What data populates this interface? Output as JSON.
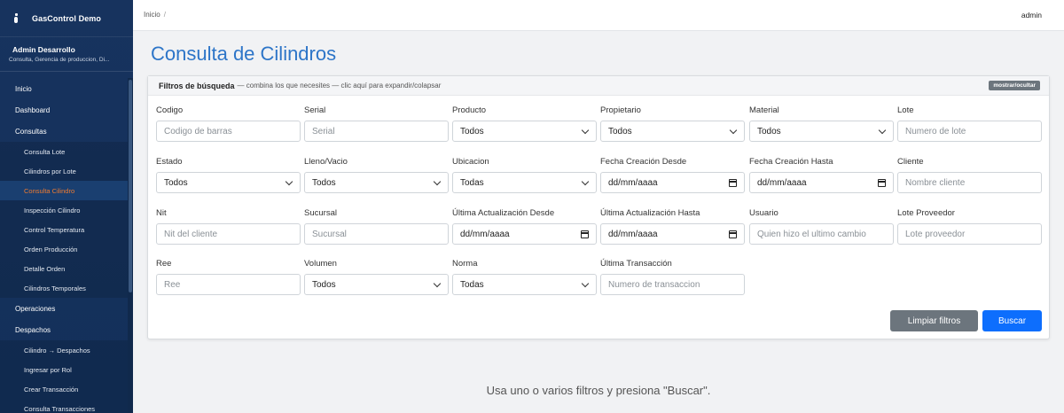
{
  "app": {
    "title": "GasControl Demo"
  },
  "user": {
    "name": "Admin Desarrollo",
    "role": "Consulta, Gerencia de produccion, Di..."
  },
  "topbar": {
    "breadcrumb": "Inicio",
    "separator": "/",
    "username": "admin"
  },
  "sidebar": {
    "items": [
      {
        "label": "Inicio",
        "type": "section"
      },
      {
        "label": "Dashboard",
        "type": "section"
      },
      {
        "label": "Consultas",
        "type": "section"
      },
      {
        "label": "Consulta Lote",
        "type": "sub"
      },
      {
        "label": "Cilindros por Lote",
        "type": "sub"
      },
      {
        "label": "Consulta Cilindro",
        "type": "sub",
        "active": true
      },
      {
        "label": "Inspección Cilindro",
        "type": "sub"
      },
      {
        "label": "Control Temperatura",
        "type": "sub"
      },
      {
        "label": "Orden Producción",
        "type": "sub"
      },
      {
        "label": "Detalle Orden",
        "type": "sub"
      },
      {
        "label": "Cilindros Temporales",
        "type": "sub"
      },
      {
        "label": "Operaciones",
        "type": "section"
      },
      {
        "label": "Despachos",
        "type": "section"
      },
      {
        "label": "Cilindro → Despachos",
        "type": "sub"
      },
      {
        "label": "Ingresar por Rol",
        "type": "sub"
      },
      {
        "label": "Crear Transacción",
        "type": "sub"
      },
      {
        "label": "Consulta Transacciones",
        "type": "sub"
      }
    ]
  },
  "page": {
    "title": "Consulta de Cilindros"
  },
  "filters": {
    "header_title": "Filtros de búsqueda",
    "header_hint": "— combina los que necesites — clic aquí para expandir/colapsar",
    "toggle_label": "mostrar/ocultar",
    "fields": {
      "codigo": {
        "label": "Codigo",
        "placeholder": "Codigo de barras"
      },
      "serial": {
        "label": "Serial",
        "placeholder": "Serial"
      },
      "producto": {
        "label": "Producto",
        "value": "Todos"
      },
      "propietario": {
        "label": "Propietario",
        "value": "Todos"
      },
      "material": {
        "label": "Material",
        "value": "Todos"
      },
      "lote": {
        "label": "Lote",
        "placeholder": "Numero de lote"
      },
      "estado": {
        "label": "Estado",
        "value": "Todos"
      },
      "lleno_vacio": {
        "label": "Lleno/Vacio",
        "value": "Todos"
      },
      "ubicacion": {
        "label": "Ubicacion",
        "value": "Todas"
      },
      "fecha_creacion_desde": {
        "label": "Fecha Creación Desde",
        "value": "dd/mm/aaaa"
      },
      "fecha_creacion_hasta": {
        "label": "Fecha Creación Hasta",
        "value": "dd/mm/aaaa"
      },
      "cliente": {
        "label": "Cliente",
        "placeholder": "Nombre cliente"
      },
      "nit": {
        "label": "Nit",
        "placeholder": "Nit del cliente"
      },
      "sucursal": {
        "label": "Sucursal",
        "placeholder": "Sucursal"
      },
      "ultima_act_desde": {
        "label": "Última Actualización Desde",
        "value": "dd/mm/aaaa"
      },
      "ultima_act_hasta": {
        "label": "Última Actualización Hasta",
        "value": "dd/mm/aaaa"
      },
      "usuario": {
        "label": "Usuario",
        "placeholder": "Quien hizo el ultimo cambio"
      },
      "lote_proveedor": {
        "label": "Lote Proveedor",
        "placeholder": "Lote proveedor"
      },
      "ree": {
        "label": "Ree",
        "placeholder": "Ree"
      },
      "volumen": {
        "label": "Volumen",
        "value": "Todos"
      },
      "norma": {
        "label": "Norma",
        "value": "Todas"
      },
      "ultima_transaccion": {
        "label": "Última Transacción",
        "placeholder": "Numero de transaccion"
      }
    },
    "clear_label": "Limpiar filtros",
    "search_label": "Buscar"
  },
  "empty_message": "Usa uno o varios filtros y presiona \"Buscar\"."
}
